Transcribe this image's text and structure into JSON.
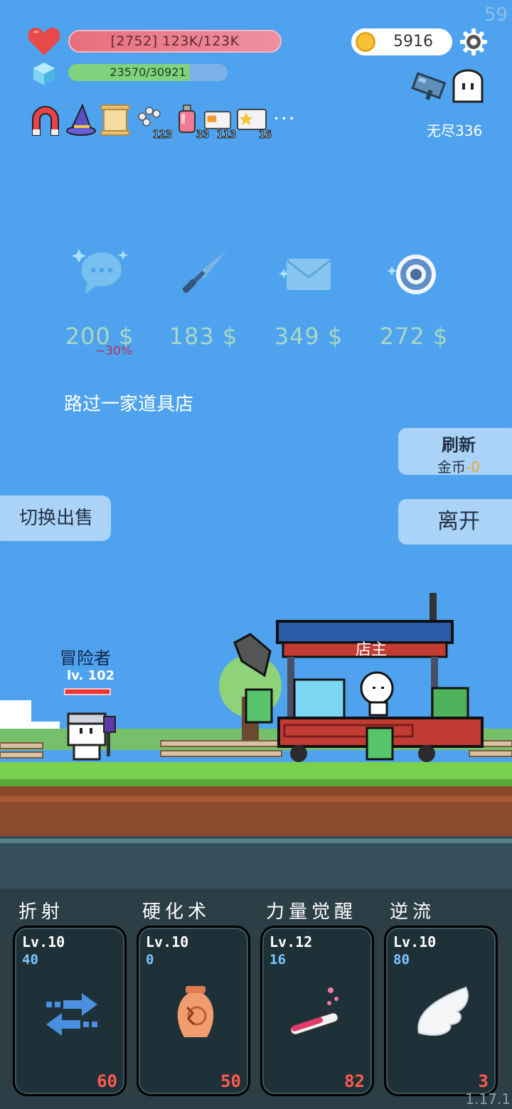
{
  "status": {
    "fps": "59",
    "hp_text": "[2752] 123K/123K",
    "exp_text": "23570/30921",
    "exp_fraction": 0.762,
    "coins": "5916",
    "endless_label": "无尽336"
  },
  "buffs": [
    {
      "icon": "magnet-icon",
      "count": ""
    },
    {
      "icon": "wizard-hat-icon",
      "count": ""
    },
    {
      "icon": "scroll-icon",
      "count": ""
    },
    {
      "icon": "pawprint-icon",
      "count": "123"
    },
    {
      "icon": "potion-bottle-icon",
      "count": "33"
    },
    {
      "icon": "briefcase-icon",
      "count": "113"
    },
    {
      "icon": "star-card-icon",
      "count": "16"
    }
  ],
  "more_label": "···",
  "shop": {
    "items": [
      {
        "icon": "chat-bubble-icon",
        "price": "200 $"
      },
      {
        "icon": "dagger-icon",
        "price": "183 $"
      },
      {
        "icon": "envelope-icon",
        "price": "349 $"
      },
      {
        "icon": "target-icon",
        "price": "272 $"
      }
    ],
    "discount": "−30%",
    "message": "路过一家道具店",
    "refresh_label": "刷新",
    "refresh_cost_prefix": "金币",
    "refresh_cost_value": "-0",
    "leave_label": "离开",
    "switch_sell_label": "切换出售"
  },
  "scene": {
    "hero_name": "冒险者",
    "hero_level": "lv. 102",
    "shopkeeper_label": "店主"
  },
  "skills": [
    {
      "name": "折射",
      "level": "Lv.10",
      "value": "40",
      "cost": "60",
      "icon": "arrows-swap-icon"
    },
    {
      "name": "硬化术",
      "level": "Lv.10",
      "value": "0",
      "cost": "50",
      "icon": "vase-icon"
    },
    {
      "name": "力量觉醒",
      "level": "Lv.12",
      "value": "16",
      "cost": "82",
      "icon": "test-tube-icon"
    },
    {
      "name": "逆流",
      "level": "Lv.10",
      "value": "80",
      "cost": "3",
      "icon": "wing-icon"
    }
  ],
  "version": "1.17.1",
  "colors": {
    "sky": "#4fa3ee",
    "hp": "#e86f7c",
    "exp": "#7fd37f",
    "price": "#a7d8c5",
    "cost": "#ff5a4e"
  }
}
